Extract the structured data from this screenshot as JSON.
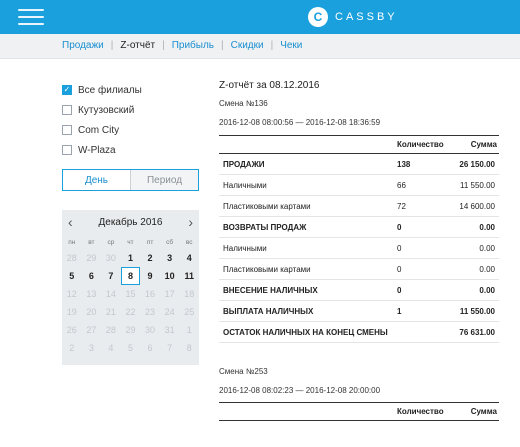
{
  "header": {
    "brand_letter": "C",
    "brand_name": "CASSBY",
    "accent": "#1aa0dc"
  },
  "nav": {
    "items": [
      "Продажи",
      "Z-отчёт",
      "Прибыль",
      "Скидки",
      "Чеки"
    ],
    "active": "Z-отчёт"
  },
  "branches": [
    {
      "label": "Все филиалы",
      "checked": true
    },
    {
      "label": "Кутузовский",
      "checked": false
    },
    {
      "label": "Com City",
      "checked": false
    },
    {
      "label": "W-Plaza",
      "checked": false
    }
  ],
  "period_switch": {
    "day": "День",
    "period": "Период",
    "selected": "День"
  },
  "calendar": {
    "title": "Декабрь 2016",
    "weekdays": [
      "пн",
      "вт",
      "ср",
      "чт",
      "пт",
      "сб",
      "вс"
    ],
    "days": [
      [
        "28",
        "29",
        "30",
        "1",
        "2",
        "3",
        "4"
      ],
      [
        "5",
        "6",
        "7",
        "8",
        "9",
        "10",
        "11"
      ],
      [
        "12",
        "13",
        "14",
        "15",
        "16",
        "17",
        "18"
      ],
      [
        "19",
        "20",
        "21",
        "22",
        "23",
        "24",
        "25"
      ],
      [
        "26",
        "27",
        "28",
        "29",
        "30",
        "31",
        "1"
      ],
      [
        "2",
        "3",
        "4",
        "5",
        "6",
        "7",
        "8"
      ]
    ],
    "selected_day": "8"
  },
  "report": {
    "title": "Z-отчёт за 08.12.2016",
    "shift1": {
      "label": "Смена №136",
      "range": "2016-12-08 08:00:56 — 2016-12-08 18:36:59"
    },
    "columns": {
      "qty": "Количество",
      "sum": "Сумма"
    },
    "rows": [
      {
        "label": "ПРОДАЖИ",
        "qty": "138",
        "sum": "26 150.00",
        "bold": true
      },
      {
        "label": "Наличными",
        "qty": "66",
        "sum": "11 550.00",
        "bold": false
      },
      {
        "label": "Пластиковыми картами",
        "qty": "72",
        "sum": "14 600.00",
        "bold": false
      },
      {
        "label": "ВОЗВРАТЫ ПРОДАЖ",
        "qty": "0",
        "sum": "0.00",
        "bold": true
      },
      {
        "label": "Наличными",
        "qty": "0",
        "sum": "0.00",
        "bold": false
      },
      {
        "label": "Пластиковыми картами",
        "qty": "0",
        "sum": "0.00",
        "bold": false
      },
      {
        "label": "ВНЕСЕНИЕ НАЛИЧНЫХ",
        "qty": "0",
        "sum": "0.00",
        "bold": true
      },
      {
        "label": "ВЫПЛАТА НАЛИЧНЫХ",
        "qty": "1",
        "sum": "11 550.00",
        "bold": true
      },
      {
        "label": "ОСТАТОК НАЛИЧНЫХ НА КОНЕЦ СМЕНЫ",
        "qty": "",
        "sum": "76 631.00",
        "bold": true
      }
    ],
    "shift2": {
      "label": "Смена №253",
      "range": "2016-12-08 08:02:23 — 2016-12-08 20:00:00"
    }
  }
}
